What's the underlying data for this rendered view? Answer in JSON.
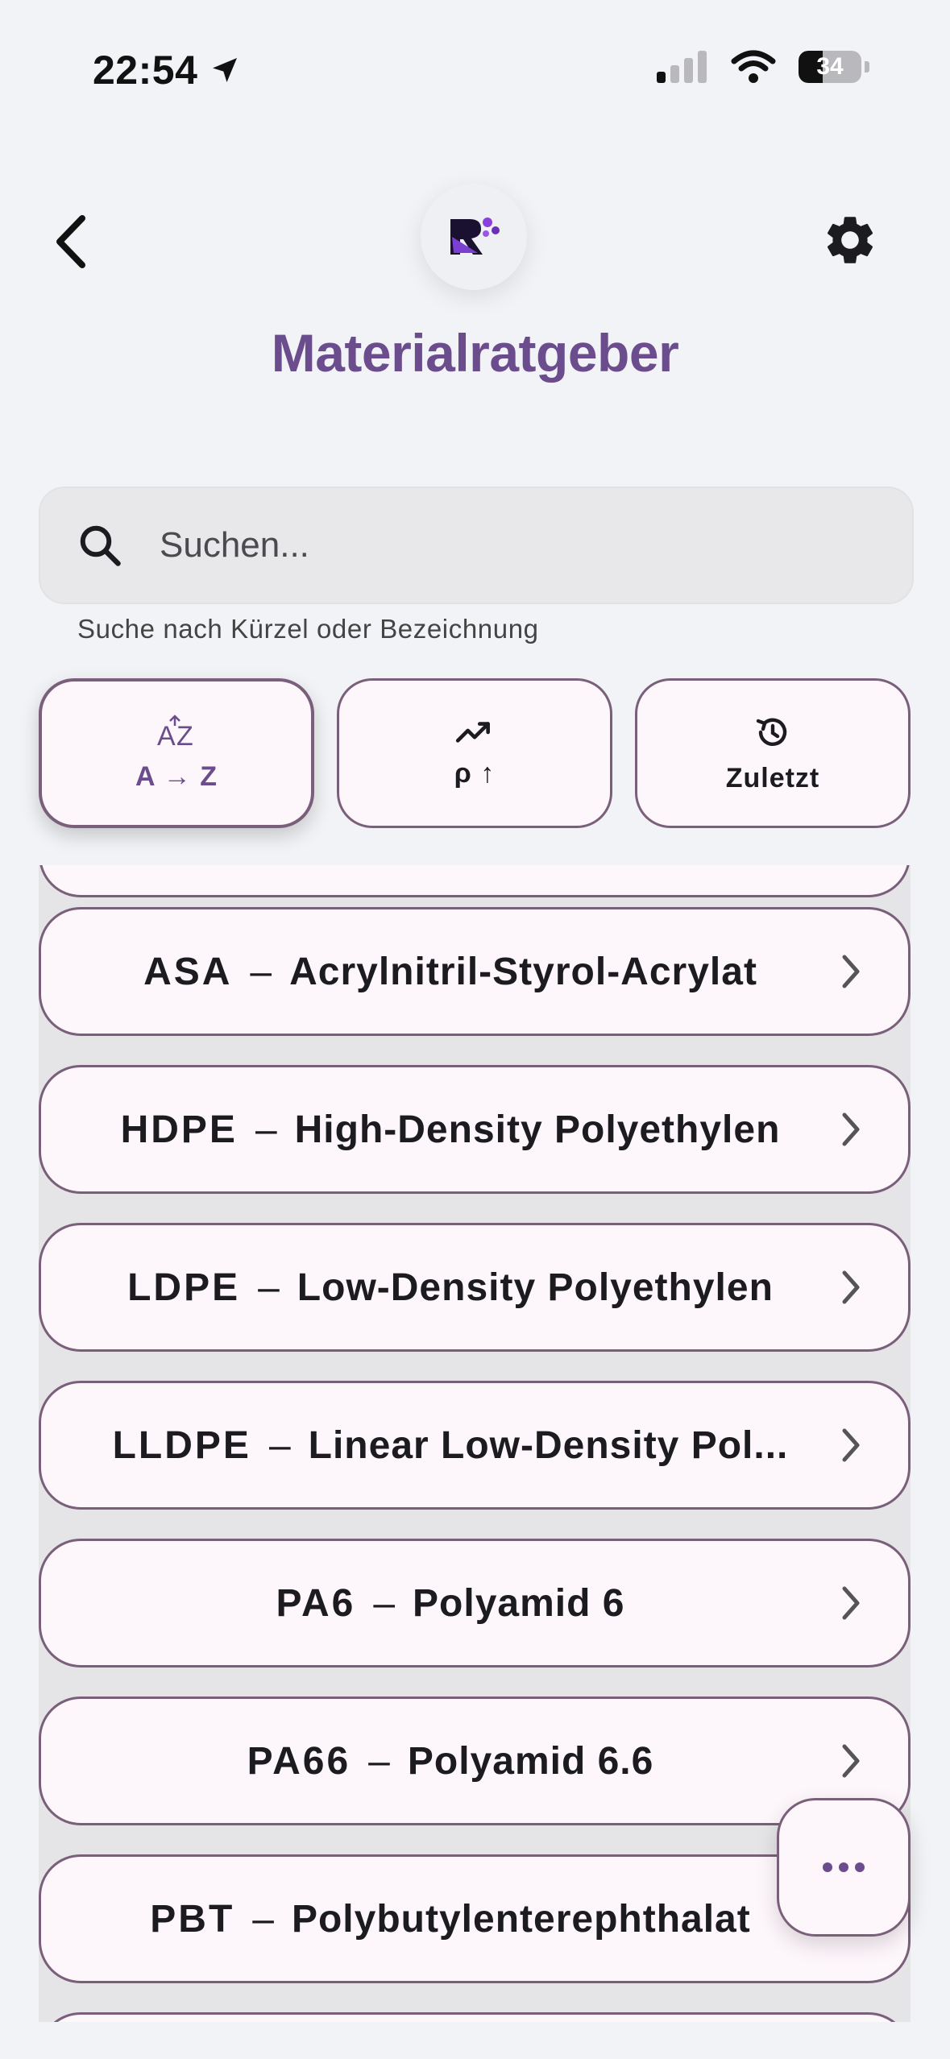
{
  "status_bar": {
    "time": "22:54",
    "battery": "34"
  },
  "header": {
    "title": "Materialratgeber",
    "back_icon": "chevron-left-icon",
    "settings_icon": "gear-icon",
    "logo": "app-logo"
  },
  "search": {
    "placeholder": "Suchen...",
    "value": "",
    "hint": "Suche nach Kürzel oder Bezeichnung"
  },
  "sort_buttons": [
    {
      "label": "A → Z",
      "icon": "sort-alpha-icon",
      "active": true
    },
    {
      "label": "ρ ↑",
      "icon": "trending-up-icon",
      "active": false
    },
    {
      "label": "Zuletzt",
      "icon": "history-icon",
      "active": false
    }
  ],
  "materials": [
    {
      "code": "ASA",
      "name": "Acrylnitril-Styrol-Acrylat"
    },
    {
      "code": "HDPE",
      "name": "High-Density Polyethylen"
    },
    {
      "code": "LDPE",
      "name": "Low-Density Polyethylen"
    },
    {
      "code": "LLDPE",
      "name": "Linear Low-Density Pol..."
    },
    {
      "code": "PA6",
      "name": "Polyamid 6"
    },
    {
      "code": "PA66",
      "name": "Polyamid 6.6"
    },
    {
      "code": "PBT",
      "name": "Polybutylenterephthalat"
    }
  ],
  "fab": {
    "icon": "more-horizontal-icon"
  },
  "colors": {
    "accent": "#6b4c8c",
    "card": "#fdf6fb",
    "border": "#7a5f7a",
    "background": "#f1f3f6"
  }
}
